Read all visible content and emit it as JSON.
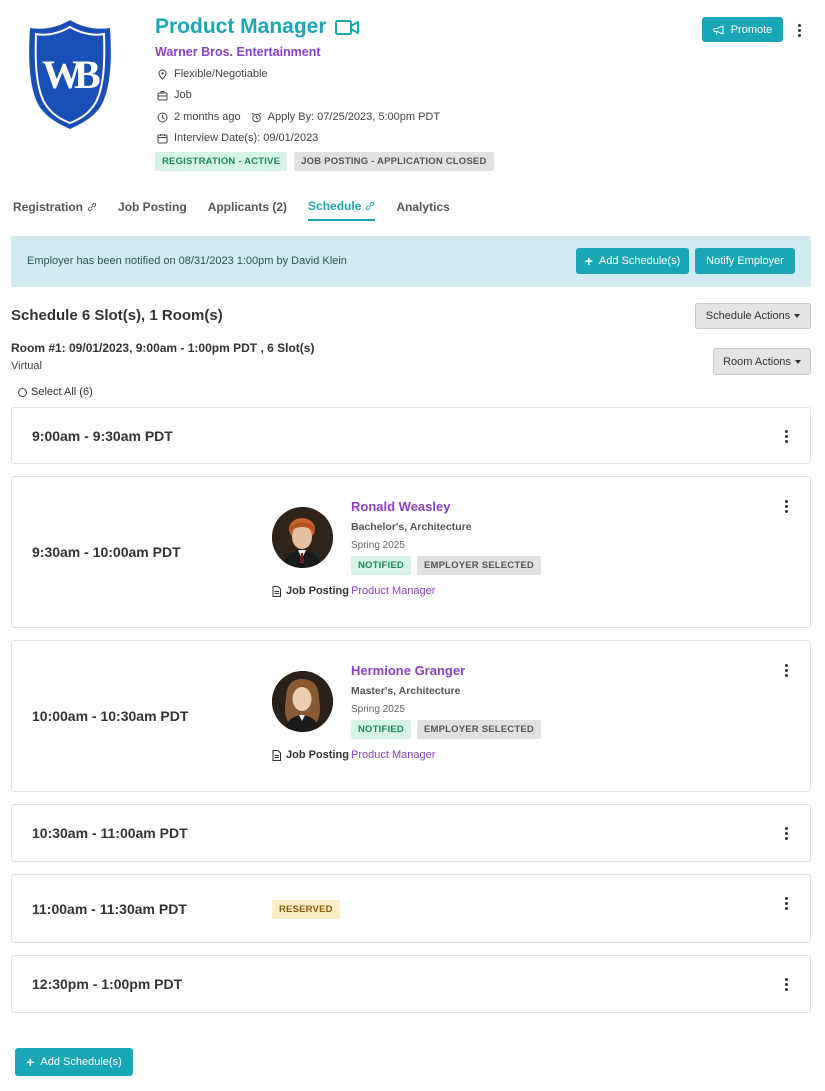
{
  "job": {
    "title": "Product Manager",
    "employer": "Warner Bros. Entertainment",
    "location": "Flexible/Negotiable",
    "type": "Job",
    "posted": "2 months ago",
    "apply_by": "Apply By: 07/25/2023, 5:00pm PDT",
    "interview": "Interview Date(s): 09/01/2023",
    "badge_registration": "REGISTRATION - ACTIVE",
    "badge_posting": "JOB POSTING - APPLICATION CLOSED",
    "promote_label": "Promote"
  },
  "tabs": [
    {
      "label": "Registration"
    },
    {
      "label": "Job Posting"
    },
    {
      "label": "Applicants (2)"
    },
    {
      "label": "Schedule"
    },
    {
      "label": "Analytics"
    }
  ],
  "notice": {
    "text": "Employer has been notified on 08/31/2023 1:00pm by David Klein",
    "add_label": "Add Schedule(s)",
    "notify_label": "Notify Employer"
  },
  "schedule": {
    "title": "Schedule 6 Slot(s), 1 Room(s)",
    "actions_label": "Schedule Actions",
    "room_title": "Room #1: 09/01/2023, 9:00am - 1:00pm PDT , 6 Slot(s)",
    "room_sub": "Virtual",
    "room_actions_label": "Room Actions",
    "select_all": "Select All (6)",
    "add_bottom_label": "Add Schedule(s)"
  },
  "slots": [
    {
      "time": "9:00am - 9:30am PDT"
    },
    {
      "time": "9:30am - 10:00am PDT",
      "candidate": {
        "name": "Ronald Weasley",
        "degree": "Bachelor's, Architecture",
        "term": "Spring 2025",
        "badge1": "NOTIFIED",
        "badge2": "EMPLOYER SELECTED",
        "posting_label": "Job Posting",
        "posting_link": "Product Manager"
      }
    },
    {
      "time": "10:00am - 10:30am PDT",
      "candidate": {
        "name": "Hermione Granger",
        "degree": "Master's, Architecture",
        "term": "Spring 2025",
        "badge1": "NOTIFIED",
        "badge2": "EMPLOYER SELECTED",
        "posting_label": "Job Posting",
        "posting_link": "Product Manager"
      }
    },
    {
      "time": "10:30am - 11:00am PDT"
    },
    {
      "time": "11:00am - 11:30am PDT",
      "badge": "RESERVED"
    },
    {
      "time": "12:30pm - 1:00pm PDT"
    }
  ],
  "colors": {
    "accent": "#1aa7b5",
    "link": "#8c3fc7",
    "logo_blue": "#1a4fb8"
  }
}
